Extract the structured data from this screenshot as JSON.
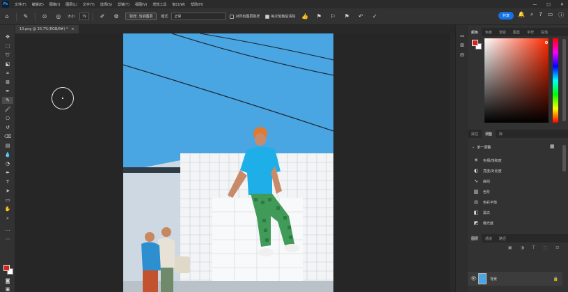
{
  "app": {
    "logo": "Ps"
  },
  "menu": [
    "文件(F)",
    "编辑(E)",
    "图像(I)",
    "图层(L)",
    "文字(Y)",
    "选择(S)",
    "滤镜(T)",
    "视图(V)",
    "增效工具",
    "窗口(W)",
    "帮助(H)"
  ],
  "window_controls": {
    "minimize": "—",
    "maximize": "□",
    "close": "✕"
  },
  "options": {
    "size_label": "大小:",
    "size_value": "79",
    "sample_all_button": "取样: 当前图层",
    "mode_label": "模式",
    "mode_value": "正常",
    "sample_all_layers": "对所有图层取样",
    "auto_enhance": "每次笔触后清除",
    "share_label": "共享"
  },
  "document": {
    "tab_title": "13.png @ 33.7%(RGB/8#) *",
    "close": "×"
  },
  "panels": {
    "color_tabs": [
      "颜色",
      "色板",
      "渐变",
      "图案",
      "字符",
      "段落"
    ],
    "adjust_tabs": [
      "属性",
      "调整",
      "库"
    ],
    "adjust_header": "单一调整",
    "adjustments": [
      {
        "icon": "☀",
        "label": "色相/饱和度"
      },
      {
        "icon": "◐",
        "label": "亮度/对比度"
      },
      {
        "icon": "∿",
        "label": "曲线"
      },
      {
        "icon": "▥",
        "label": "色阶"
      },
      {
        "icon": "⚖",
        "label": "色彩平衡"
      },
      {
        "icon": "◧",
        "label": "黑白"
      },
      {
        "icon": "◩",
        "label": "曝光度"
      }
    ],
    "layer_tabs": [
      "图层",
      "通道",
      "路径"
    ],
    "layer_name": "背景"
  },
  "colors": {
    "foreground": "#d6261b",
    "background": "#ffffff",
    "accent": "#1473e6"
  }
}
